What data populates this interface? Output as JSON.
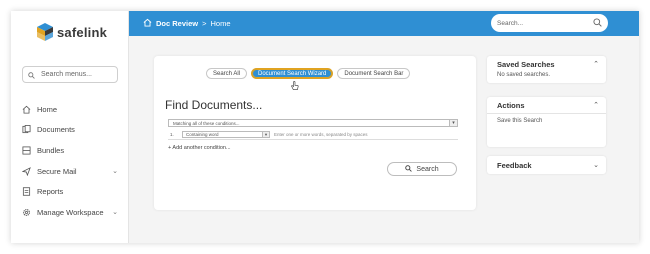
{
  "brand": {
    "name": "safelink",
    "colors": {
      "primary": "#2f8fd3",
      "accent": "#e0a321"
    }
  },
  "sidebar": {
    "search_placeholder": "Search menus...",
    "items": [
      {
        "label": "Home",
        "icon": "home-icon",
        "chevron": false
      },
      {
        "label": "Documents",
        "icon": "documents-icon",
        "chevron": false
      },
      {
        "label": "Bundles",
        "icon": "bundles-icon",
        "chevron": false
      },
      {
        "label": "Secure Mail",
        "icon": "send-icon",
        "chevron": true
      },
      {
        "label": "Reports",
        "icon": "reports-icon",
        "chevron": false
      },
      {
        "label": "Manage Workspace",
        "icon": "gear-icon",
        "chevron": true
      }
    ]
  },
  "topbar": {
    "breadcrumb_doc": "Doc Review",
    "breadcrumb_sep": ">",
    "breadcrumb_page": "Home",
    "search_placeholder": "Search..."
  },
  "main": {
    "tabs": [
      "Search All",
      "Document Search Wizard",
      "Document Search Bar"
    ],
    "active_tab": "Document Search Wizard",
    "title": "Find Documents...",
    "condition_match": "Matching all of these conditions...",
    "condition_row": {
      "number": "1.",
      "field": "Containing word",
      "placeholder": "Enter one or more words, separated by spaces"
    },
    "add_condition": "+ Add another condition...",
    "search_button": "Search"
  },
  "panels": {
    "saved_searches": {
      "title": "Saved Searches",
      "body": "No saved searches."
    },
    "actions": {
      "title": "Actions",
      "body": "Save this Search"
    },
    "feedback": {
      "title": "Feedback"
    }
  }
}
